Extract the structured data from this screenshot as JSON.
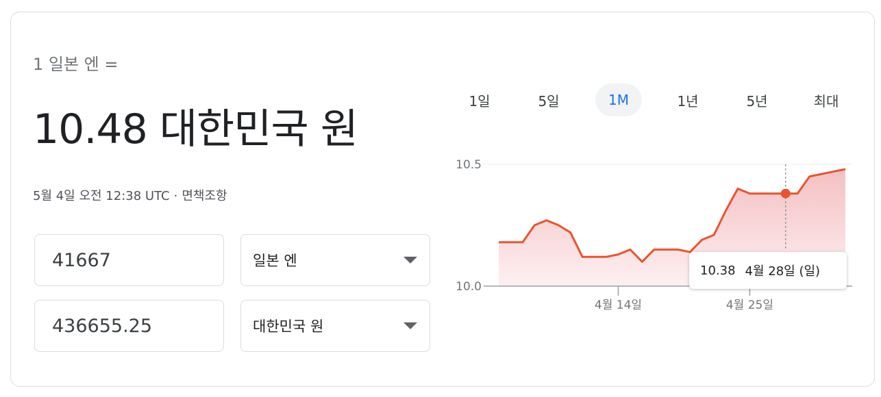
{
  "converter": {
    "from_label": "1 일본 엔 =",
    "result_text": "10.48 대한민국 원",
    "timestamp": "5월 4일 오전 12:38 UTC",
    "separator": "·",
    "disclaimer": "면책조항",
    "amount_from": "41667",
    "amount_to": "436655.25",
    "currency_from": "일본 엔",
    "currency_to": "대한민국 원"
  },
  "tabs": [
    {
      "label": "1일"
    },
    {
      "label": "5일"
    },
    {
      "label": "1M",
      "active": true
    },
    {
      "label": "1년"
    },
    {
      "label": "5년"
    },
    {
      "label": "최대"
    }
  ],
  "tooltip": {
    "value": "10.38",
    "date": "4월 28일 (일)"
  },
  "colors": {
    "line": "#e8542d",
    "fill_top": "#f3b9bc",
    "fill_bottom": "#fdeef0",
    "active_tab": "#1a73e8"
  },
  "chart_data": {
    "type": "area",
    "y_ticks": [
      "10.5",
      "10.0"
    ],
    "ylim": [
      10.0,
      10.5
    ],
    "x_ticks": [
      "4월 14일",
      "4월 25일"
    ],
    "grid": true,
    "highlight_index": 24,
    "values": [
      10.18,
      10.18,
      10.18,
      10.25,
      10.27,
      10.25,
      10.22,
      10.12,
      10.12,
      10.12,
      10.13,
      10.15,
      10.1,
      10.15,
      10.15,
      10.15,
      10.14,
      10.19,
      10.21,
      10.31,
      10.4,
      10.38,
      10.38,
      10.38,
      10.38,
      10.38,
      10.45,
      10.46,
      10.47,
      10.48
    ]
  }
}
